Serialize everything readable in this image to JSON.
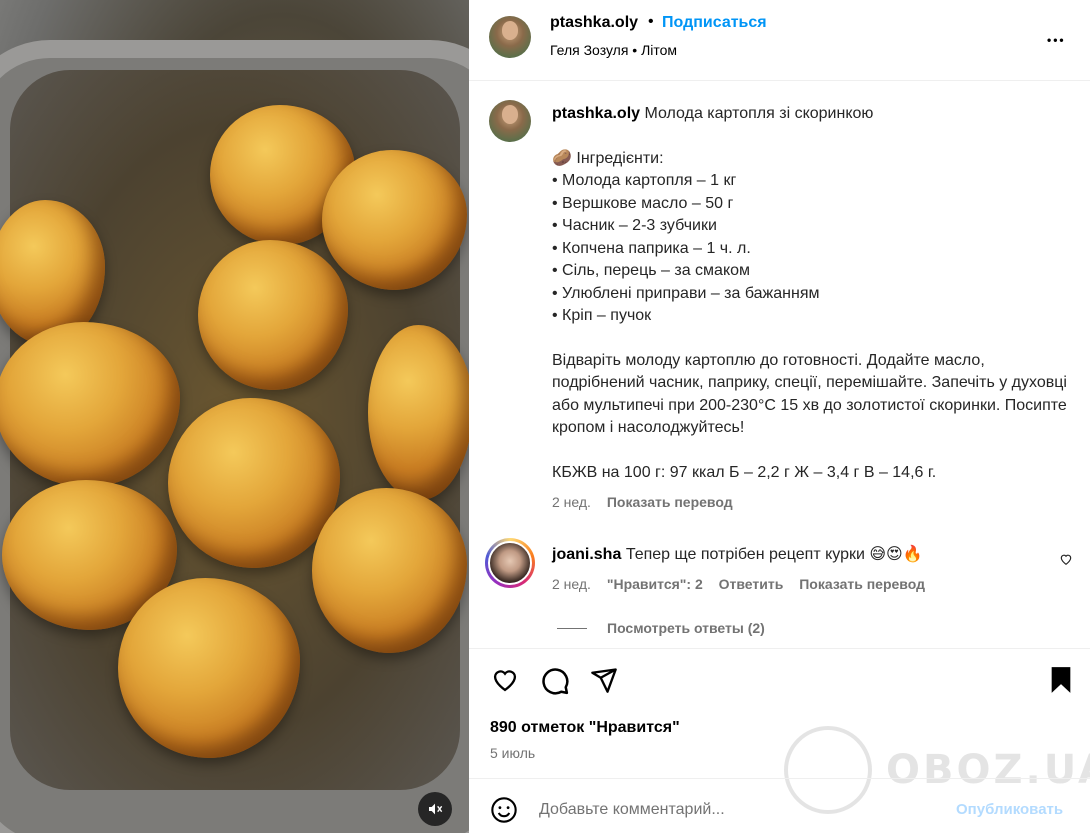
{
  "header": {
    "username": "ptashka.oly",
    "dot": "•",
    "follow_label": "Подписаться",
    "subtitle": "Геля Зозуля • Літом",
    "more": "•••"
  },
  "caption": {
    "username": "ptashka.oly",
    "title": "Молода картопля зі скоринкою",
    "ingredients_header": "🥔 Інгредієнти:",
    "ingredients": [
      "• Молода картопля – 1 кг",
      "• Вершкове масло – 50 г",
      "• Часник – 2-3 зубчики",
      "• Копчена паприка – 1 ч. л.",
      "• Сіль, перець – за смаком",
      "• Улюблені приправи – за бажанням",
      "• Кріп – пучок"
    ],
    "instructions": "Відваріть молоду картоплю до готовності. Додайте масло, подрібнений часник, паприку, спеції, перемішайте. Запечіть у духовці або мультипечі при 200-230°C 15 хв до золотистої скоринки. Посипте кропом і насолоджуйтесь!",
    "nutrition": "КБЖВ на 100 г: 97 ккал Б – 2,2 г Ж – 3,4 г В – 14,6 г.",
    "time": "2 нед.",
    "translate": "Показать перевод"
  },
  "comment": {
    "username": "joani.sha",
    "text": "Тепер ще потрібен рецепт курки 😅😍🔥",
    "time": "2 нед.",
    "likes": "\"Нравится\": 2",
    "reply": "Ответить",
    "translate": "Показать перевод",
    "view_replies": "Посмотреть ответы (2)"
  },
  "post": {
    "likes": "890 отметок \"Нравится\"",
    "date": "5 июль"
  },
  "add_comment": {
    "placeholder": "Добавьте комментарий...",
    "publish": "Опубликовать"
  },
  "watermark": {
    "text": "OBOZ.UA"
  },
  "colors": {
    "accent": "#0095f6",
    "muted": "#737373",
    "publish_disabled": "#b3dbff"
  }
}
